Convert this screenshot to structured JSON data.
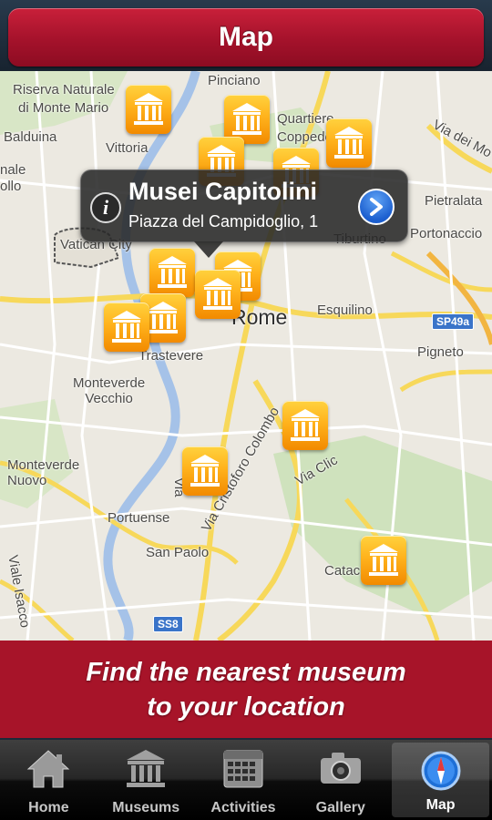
{
  "header": {
    "title": "Map"
  },
  "map": {
    "labels": {
      "riserva": "Riserva Naturale",
      "monte_mario": "di Monte Mario",
      "balduina": "Balduina",
      "vittoria": "Vittoria",
      "pinciano": "Pinciano",
      "quartiere": "Quartiere",
      "coppede": "Coppedè",
      "via_dei_mo": "Via dei Mo",
      "pietralata": "Pietralata",
      "portonaccio": "Portonaccio",
      "tiburtino": "Tiburtino",
      "vatican": "Vatican City",
      "rome": "Rome",
      "esquilino": "Esquilino",
      "pigneto": "Pigneto",
      "trastevere": "Trastevere",
      "monteverde_vecchio": "Monteverde\nVecchio",
      "monteverde_nuovo": "Monteverde\nNuovo",
      "portuense": "Portuense",
      "san_paolo": "San Paolo",
      "via_cristoforo": "Via Cristoforo Colombo",
      "via_clic": "Via Clic",
      "viale_isacco": "Viale Isacco",
      "catac": "Catac",
      "male": "nale",
      "ollo": "ollo",
      "via_a": "Via"
    },
    "shields": {
      "sp49a": "SP49a",
      "ss8": "SS8"
    }
  },
  "callout": {
    "name": "Musei Capitolini",
    "address": "Piazza del Campidoglio, 1",
    "info_glyph": "i"
  },
  "banner": {
    "line1": "Find the nearest museum",
    "line2": "to your location"
  },
  "tabs": [
    {
      "label": "Home",
      "icon": "home-icon"
    },
    {
      "label": "Museums",
      "icon": "museum-icon"
    },
    {
      "label": "Activities",
      "icon": "calendar-icon"
    },
    {
      "label": "Gallery",
      "icon": "camera-icon"
    },
    {
      "label": "Map",
      "icon": "compass-icon",
      "active": true
    }
  ],
  "colors": {
    "brand_red": "#a71429",
    "pin_orange": "#ffb21c",
    "road_yellow": "#f7d85a"
  }
}
